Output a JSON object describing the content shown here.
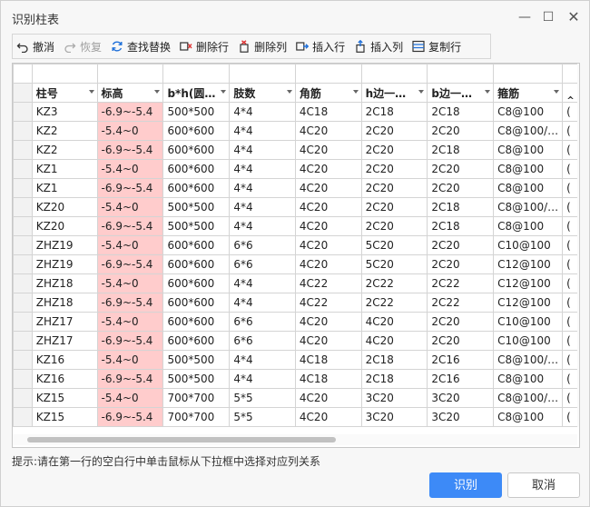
{
  "window": {
    "title": "识别柱表"
  },
  "toolbar": {
    "undo": "撤消",
    "redo": "恢复",
    "find_replace": "查找替换",
    "delete_row": "删除行",
    "delete_col": "删除列",
    "insert_row": "插入行",
    "insert_col": "插入列",
    "copy_row": "复制行"
  },
  "table": {
    "headers": [
      "柱号",
      "标高",
      "b*h(圆…",
      "肢数",
      "角筋",
      "h边一…",
      "b边一…",
      "箍筋",
      "‸"
    ],
    "rows": [
      [
        "KZ3",
        "-6.9~-5.4",
        "500*500",
        "4*4",
        "4C18",
        "2C18",
        "2C18",
        "C8@100",
        "("
      ],
      [
        "KZ2",
        "-5.4~0",
        "600*600",
        "4*4",
        "4C20",
        "2C20",
        "2C20",
        "C8@100/…",
        "("
      ],
      [
        "KZ2",
        "-6.9~-5.4",
        "600*600",
        "4*4",
        "4C20",
        "2C20",
        "2C18",
        "C8@100",
        "("
      ],
      [
        "KZ1",
        "-5.4~0",
        "600*600",
        "4*4",
        "4C20",
        "2C20",
        "2C20",
        "C8@100",
        "("
      ],
      [
        "KZ1",
        "-6.9~-5.4",
        "600*600",
        "4*4",
        "4C20",
        "2C20",
        "2C20",
        "C8@100",
        "("
      ],
      [
        "KZ20",
        "-5.4~0",
        "500*500",
        "4*4",
        "4C20",
        "2C20",
        "2C18",
        "C8@100/…",
        "("
      ],
      [
        "KZ20",
        "-6.9~-5.4",
        "500*500",
        "4*4",
        "4C20",
        "2C20",
        "2C18",
        "C8@100",
        "("
      ],
      [
        "ZHZ19",
        "-5.4~0",
        "600*600",
        "6*6",
        "4C20",
        "5C20",
        "2C20",
        "C10@100",
        "("
      ],
      [
        "ZHZ19",
        "-6.9~-5.4",
        "600*600",
        "6*6",
        "4C20",
        "5C20",
        "2C20",
        "C12@100",
        "("
      ],
      [
        "ZHZ18",
        "-5.4~0",
        "600*600",
        "4*4",
        "4C22",
        "2C22",
        "2C22",
        "C12@100",
        "("
      ],
      [
        "ZHZ18",
        "-6.9~-5.4",
        "600*600",
        "4*4",
        "4C22",
        "2C22",
        "2C22",
        "C12@100",
        "("
      ],
      [
        "ZHZ17",
        "-5.4~0",
        "600*600",
        "6*6",
        "4C20",
        "4C20",
        "2C20",
        "C10@100",
        "("
      ],
      [
        "ZHZ17",
        "-6.9~-5.4",
        "600*600",
        "6*6",
        "4C20",
        "4C20",
        "2C20",
        "C10@100",
        "("
      ],
      [
        "KZ16",
        "-5.4~0",
        "500*500",
        "4*4",
        "4C18",
        "2C18",
        "2C16",
        "C8@100/…",
        "("
      ],
      [
        "KZ16",
        "-6.9~-5.4",
        "500*500",
        "4*4",
        "4C18",
        "2C18",
        "2C16",
        "C8@100",
        "("
      ],
      [
        "KZ15",
        "-5.4~0",
        "700*700",
        "5*5",
        "4C20",
        "3C20",
        "3C20",
        "C8@100/…",
        "("
      ],
      [
        "KZ15",
        "-6.9~-5.4",
        "700*700",
        "5*5",
        "4C20",
        "3C20",
        "3C20",
        "C8@100",
        "("
      ]
    ]
  },
  "hint": "提示:请在第一行的空白行中单击鼠标从下拉框中选择对应列关系",
  "buttons": {
    "confirm": "识别",
    "cancel": "取消"
  },
  "colors": {
    "highlight": "#ffcccc",
    "primary": "#3d8af7"
  }
}
